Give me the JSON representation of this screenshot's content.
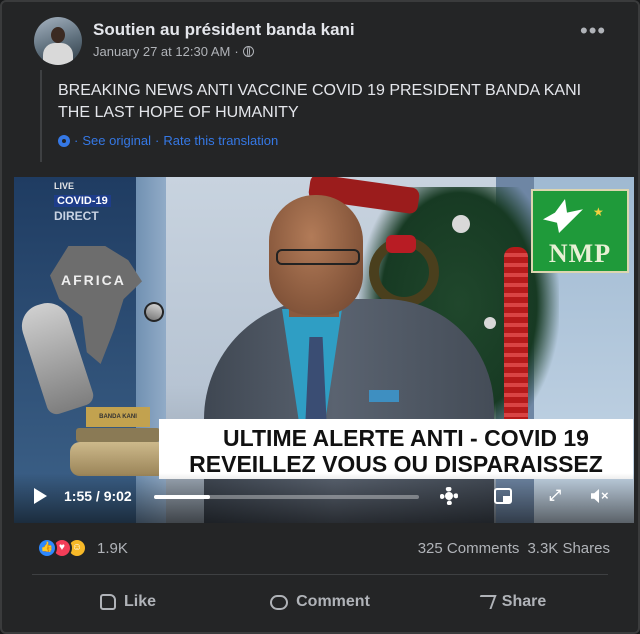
{
  "post": {
    "page_name": "Soutien au président banda kani",
    "timestamp": "January 27 at 12:30 AM",
    "separator": "·",
    "text": "BREAKING NEWS ANTI VACCINE COVID 19 PRESIDENT BANDA KANI THE LAST HOPE OF HUMANITY",
    "see_original": "See original",
    "rate_translation": "Rate this translation",
    "more_icon": "more-options-icon"
  },
  "video": {
    "badge": {
      "line1": "LIVE",
      "line2": "COVID-19",
      "line3": "DIRECT"
    },
    "africa_label": "AFRICA",
    "plaque_text": "BANDA KANI",
    "nmp_label": "NMP",
    "banner_line1": "ULTIME ALERTE ANTI - COVID 19",
    "banner_line2": "REVEILLEZ VOUS OU DISPARAISSEZ",
    "time": "1:55 / 9:02",
    "progress_fraction": 0.21,
    "expand_glyph": "⤢",
    "mute_glyph": "×"
  },
  "engagement": {
    "reactions_count": "1.9K",
    "comments": "325 Comments",
    "shares": "3.3K Shares",
    "reaction_icons": [
      "like-reaction-icon",
      "love-reaction-icon",
      "care-reaction-icon"
    ]
  },
  "actions": {
    "like": "Like",
    "comment": "Comment",
    "share": "Share"
  },
  "colors": {
    "background": "#242526",
    "link": "#3578e5",
    "text_primary": "#e4e6eb",
    "text_secondary": "#b0b3b8"
  }
}
